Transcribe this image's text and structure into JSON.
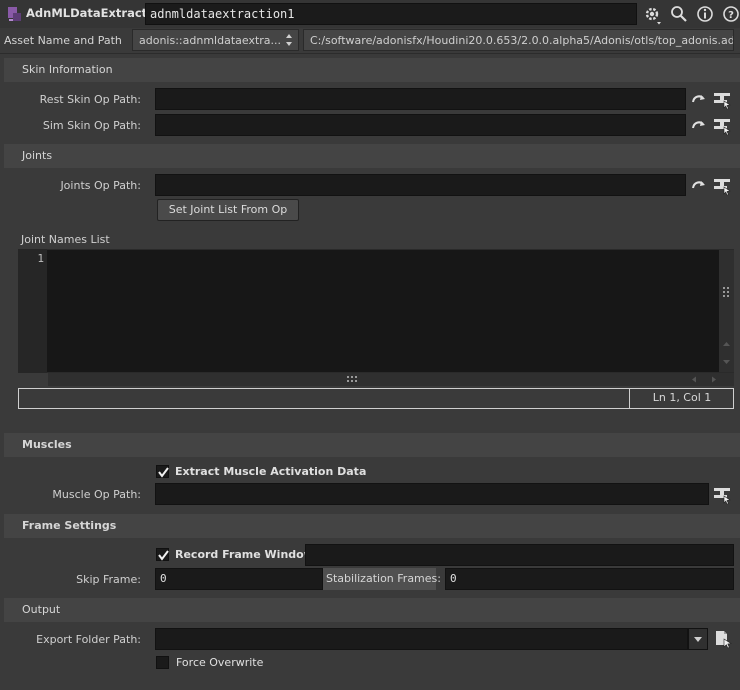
{
  "header": {
    "node_type": "AdnMLDataExtraction",
    "node_name": "adnmldataextraction1",
    "icons": [
      "node-type-icon",
      "gear-icon",
      "search-icon",
      "info-icon",
      "help-icon"
    ]
  },
  "asset": {
    "label": "Asset Name and Path",
    "name_value": "adonis::adnmldataextra...",
    "path_value": "C:/software/adonisfx/Houdini20.0.653/2.0.0.alpha5/Adonis/otls/top_adonis.ad..."
  },
  "skin": {
    "title": "Skin Information",
    "rest_label": "Rest Skin Op Path:",
    "rest_value": "",
    "sim_label": "Sim Skin Op Path:",
    "sim_value": ""
  },
  "joints": {
    "title": "Joints",
    "op_label": "Joints Op Path:",
    "op_value": "",
    "set_button": "Set Joint List From Op",
    "list_label": "Joint Names List",
    "line_number": "1",
    "status": "Ln 1, Col 1"
  },
  "muscles": {
    "title": "Muscles",
    "extract_label": "Extract Muscle Activation Data",
    "extract_checked": true,
    "op_label": "Muscle Op Path:",
    "op_value": ""
  },
  "frames": {
    "title": "Frame Settings",
    "record_label": "Record Frame Windows:",
    "record_checked": true,
    "record_value": "",
    "skip_label": "Skip Frame:",
    "skip_value": "0",
    "stab_label": "Stabilization Frames:",
    "stab_value": "0"
  },
  "output": {
    "title": "Output",
    "export_label": "Export Folder Path:",
    "export_value": "",
    "overwrite_label": "Force Overwrite",
    "overwrite_checked": false
  },
  "colors": {
    "background": "#3a3a3a",
    "section": "#444444",
    "field": "#1a1a1a",
    "node_icon": "#8a5aa8"
  }
}
